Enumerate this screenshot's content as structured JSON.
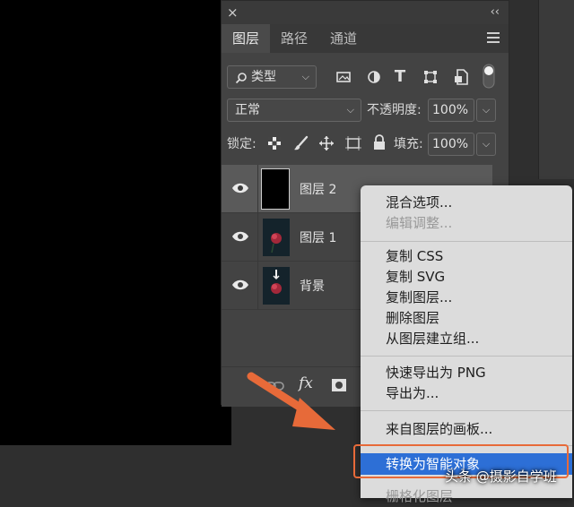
{
  "tabs": [
    {
      "label": "图层",
      "active": true
    },
    {
      "label": "路径",
      "active": false
    },
    {
      "label": "通道",
      "active": false
    }
  ],
  "filter": {
    "kind_label": "类型"
  },
  "blend": {
    "mode": "正常",
    "opacity_label": "不透明度:",
    "opacity_value": "100%"
  },
  "lock": {
    "label": "锁定:",
    "fill_label": "填充:",
    "fill_value": "100%"
  },
  "layers": [
    {
      "name": "图层 2",
      "selected": true
    },
    {
      "name": "图层 1",
      "selected": false
    },
    {
      "name": "背景",
      "selected": false
    }
  ],
  "bottom_icons": [
    "link-icon",
    "fx-icon",
    "mask-icon"
  ],
  "context_menu": {
    "items": [
      {
        "label": "混合选项...",
        "disabled": false
      },
      {
        "label": "编辑调整...",
        "disabled": true
      },
      {
        "label": "复制 CSS",
        "disabled": false
      },
      {
        "label": "复制 SVG",
        "disabled": false
      },
      {
        "label": "复制图层...",
        "disabled": false
      },
      {
        "label": "删除图层",
        "disabled": false
      },
      {
        "label": "从图层建立组...",
        "disabled": false
      },
      {
        "label": "快速导出为 PNG",
        "disabled": false
      },
      {
        "label": "导出为...",
        "disabled": false
      },
      {
        "label": "来自图层的画板...",
        "disabled": false
      },
      {
        "label": "转换为智能对象",
        "disabled": false,
        "highlighted": true
      },
      {
        "label": "栅格化图层",
        "disabled": true
      }
    ]
  },
  "fx_label": "fx",
  "watermark": "头条 @摄影自学班",
  "colors": {
    "highlight": "#2d6fd6",
    "annotation": "#e76a39"
  }
}
